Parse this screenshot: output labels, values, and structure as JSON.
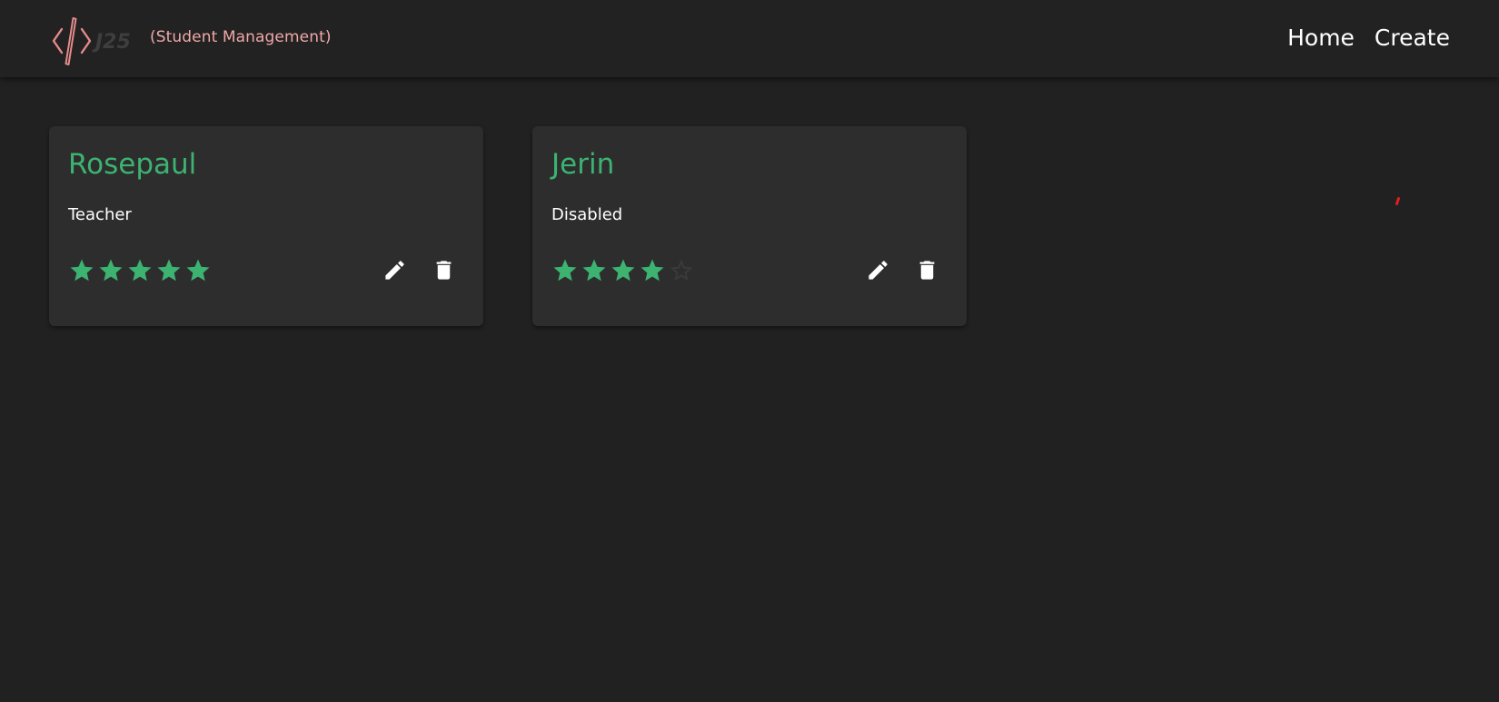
{
  "header": {
    "logo_text": "J25",
    "tagline": "(Student Management)",
    "nav": [
      {
        "label": "Home"
      },
      {
        "label": "Create"
      }
    ]
  },
  "cards": [
    {
      "name": "Rosepaul",
      "role": "Teacher",
      "rating": 5,
      "max_rating": 5
    },
    {
      "name": "Jerin",
      "role": "Disabled",
      "rating": 4,
      "max_rating": 5
    }
  ],
  "icons": {
    "star": "star-icon",
    "edit": "pencil-icon",
    "delete": "trash-icon"
  },
  "colors": {
    "background": "#212121",
    "navbar": "#222222",
    "card": "#2d2d2d",
    "accent": "#3cb371",
    "tagline": "#f0a8a8",
    "logo": "#e58a8a",
    "empty_star": "#3a3a3a"
  }
}
